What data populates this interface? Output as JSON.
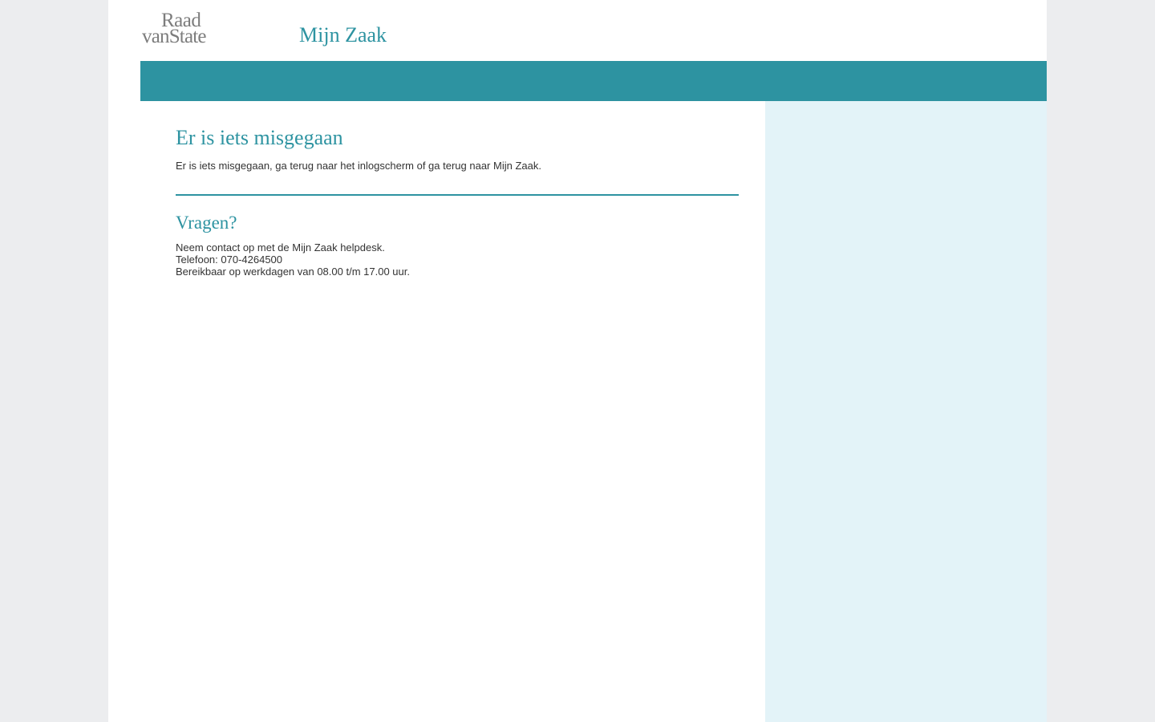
{
  "header": {
    "logo": {
      "line1": "Raad",
      "line2": "vanState"
    },
    "app_title": "Mijn Zaak"
  },
  "main": {
    "error_title": "Er is iets misgegaan",
    "error_text": "Er is iets misgegaan, ga terug naar het inlogscherm of ga terug naar Mijn Zaak.",
    "help_title": "Vragen?",
    "help_lines": [
      "Neem contact op met de Mijn Zaak helpdesk.",
      "Telefoon: 070-4264500",
      "Bereikbaar op werkdagen van 08.00 t/m 17.00 uur."
    ]
  },
  "colors": {
    "accent": "#2d93a1",
    "sidebar_bg": "#e3f3f8",
    "outer_bg": "#ecedef",
    "logo_gray": "#7d7d7d"
  }
}
